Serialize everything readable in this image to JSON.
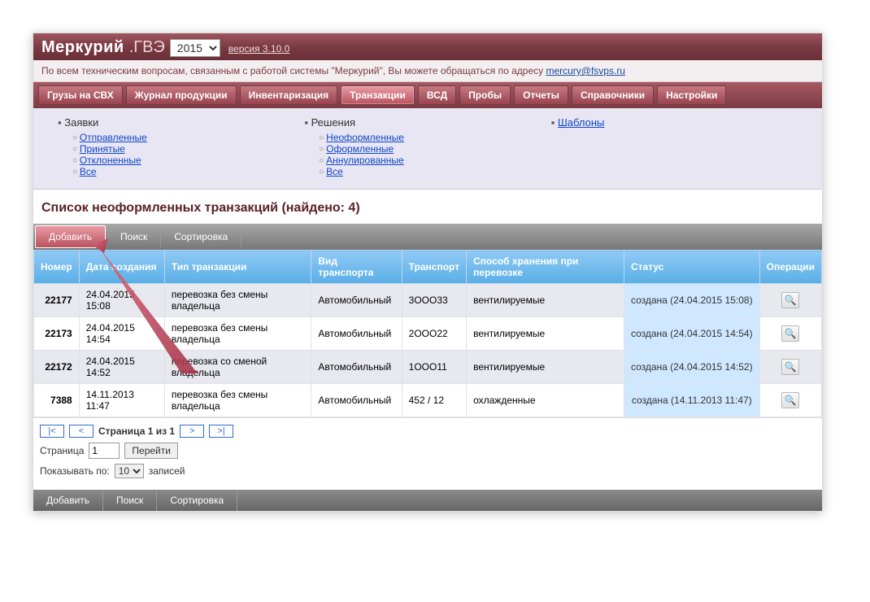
{
  "header": {
    "brand_main": "Меркурий",
    "brand_sub": ".ГВЭ",
    "year": "2015",
    "version_label": "версия 3.10.0"
  },
  "subbar": {
    "text": "По всем техническим вопросам, связанным с работой системы \"Меркурий\", Вы можете обращаться по адресу ",
    "email": "mercury@fsvps.ru"
  },
  "tabs": [
    "Грузы на СВХ",
    "Журнал продукции",
    "Инвентаризация",
    "Транзакции",
    "ВСД",
    "Пробы",
    "Отчеты",
    "Справочники",
    "Настройки"
  ],
  "active_tab_index": 3,
  "subnav": {
    "col1": {
      "title": "Заявки",
      "items": [
        "Отправленные",
        "Принятые",
        "Отклоненные",
        "Все"
      ]
    },
    "col2": {
      "title": "Решения",
      "items": [
        "Неоформленные",
        "Оформленные",
        "Аннулированные",
        "Все"
      ]
    },
    "col3": {
      "title": "Шаблоны"
    }
  },
  "page_title": "Список неоформленных транзакций (найдено: 4)",
  "toolbar": {
    "add": "Добавить",
    "search": "Поиск",
    "sort": "Сортировка"
  },
  "columns": [
    "Номер",
    "Дата создания",
    "Тип транзакции",
    "Вид транспорта",
    "Транспорт",
    "Способ хранения при перевозке",
    "Статус",
    "Операции"
  ],
  "rows": [
    {
      "num": "22177",
      "date": "24.04.2015 15:08",
      "type": "перевозка без смены владельца",
      "mode": "Автомобильный",
      "vehicle": "3ООО33",
      "storage": "вентилируемые",
      "status": "создана (24.04.2015 15:08)"
    },
    {
      "num": "22173",
      "date": "24.04.2015 14:54",
      "type": "перевозка без смены владельца",
      "mode": "Автомобильный",
      "vehicle": "2ООО22",
      "storage": "вентилируемые",
      "status": "создана (24.04.2015 14:54)"
    },
    {
      "num": "22172",
      "date": "24.04.2015 14:52",
      "type": "перевозка со сменой владельца",
      "mode": "Автомобильный",
      "vehicle": "1ООО11",
      "storage": "вентилируемые",
      "status": "создана (24.04.2015 14:52)"
    },
    {
      "num": "7388",
      "date": "14.11.2013 11:47",
      "type": "перевозка без смены владельца",
      "mode": "Автомобильный",
      "vehicle": "452 / 12",
      "storage": "охлажденные",
      "status": "создана (14.11.2013 11:47)"
    }
  ],
  "pager": {
    "first": "|<",
    "prev": "<",
    "next": ">",
    "last": ">|",
    "page_of": "Страница 1 из 1",
    "page_label": "Страница",
    "page_value": "1",
    "go": "Перейти",
    "show_label": "Показывать по:",
    "show_value": "10",
    "show_suffix": "записей"
  }
}
